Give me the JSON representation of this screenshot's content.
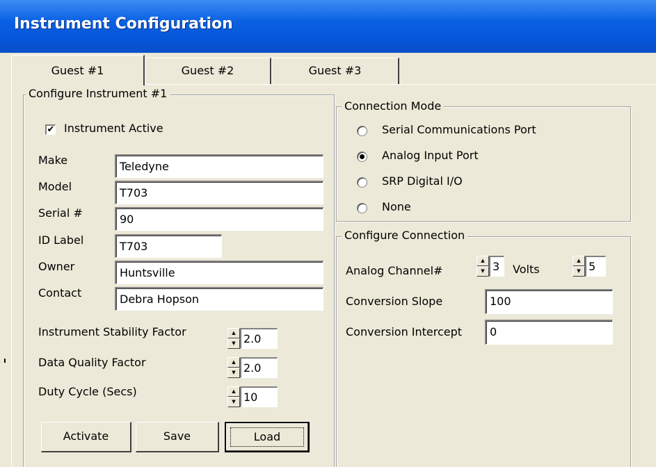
{
  "window": {
    "title": "Instrument Configuration"
  },
  "tabs": [
    {
      "label": "Guest #1",
      "active": true
    },
    {
      "label": "Guest #2",
      "active": false
    },
    {
      "label": "Guest #3",
      "active": false
    }
  ],
  "configure_instrument": {
    "group_label": "Configure Instrument #1",
    "instrument_active": {
      "label": "Instrument Active",
      "checked": true,
      "mark": "✔"
    },
    "fields": {
      "make": {
        "label": "Make",
        "value": "Teledyne"
      },
      "model": {
        "label": "Model",
        "value": "T703"
      },
      "serial": {
        "label": "Serial #",
        "value": "90"
      },
      "id_label": {
        "label": "ID Label",
        "value": "T703"
      },
      "owner": {
        "label": "Owner",
        "value": "Huntsville"
      },
      "contact": {
        "label": "Contact",
        "value": "Debra Hopson"
      }
    },
    "stability_factor": {
      "label": "Instrument Stability Factor",
      "value": "2.0"
    },
    "data_quality_factor": {
      "label": "Data Quality Factor",
      "value": "2.0"
    },
    "duty_cycle": {
      "label": "Duty Cycle (Secs)",
      "value": "10"
    }
  },
  "connection_mode": {
    "group_label": "Connection Mode",
    "options": [
      {
        "label": "Serial Communications Port",
        "selected": false
      },
      {
        "label": "Analog Input Port",
        "selected": true
      },
      {
        "label": "SRP Digital I/O",
        "selected": false
      },
      {
        "label": "None",
        "selected": false
      }
    ]
  },
  "configure_connection": {
    "group_label": "Configure Connection",
    "analog_channel": {
      "label": "Analog Channel#",
      "value": "3"
    },
    "volts": {
      "label": "Volts",
      "value": "5"
    },
    "conversion_slope": {
      "label": "Conversion Slope",
      "value": "100"
    },
    "conversion_intercept": {
      "label": "Conversion Intercept",
      "value": "0"
    }
  },
  "buttons": {
    "activate": "Activate",
    "save": "Save",
    "load": "Load"
  },
  "icons": {
    "spin_up": "▲",
    "spin_down": "▼"
  },
  "colors": {
    "titlebar": "#0a61e3",
    "window_bg": "#ece9d8"
  }
}
